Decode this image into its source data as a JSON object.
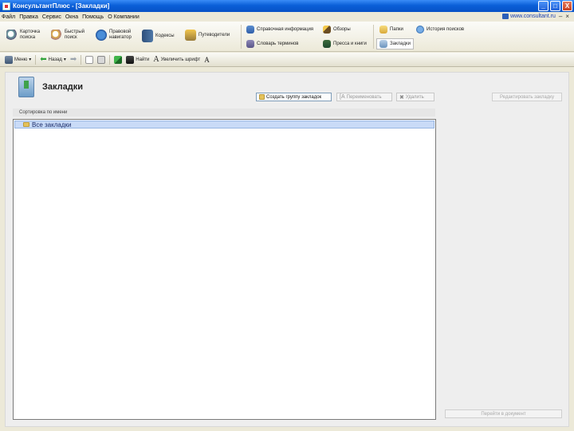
{
  "window": {
    "title": "КонсультантПлюс - [Закладки]",
    "controls": [
      "_",
      "□",
      "X"
    ]
  },
  "menu": {
    "items": [
      "Файл",
      "Правка",
      "Сервис",
      "Окна",
      "Помощь",
      "О Компании"
    ],
    "site_link": "www.consultant.ru",
    "min_ctl": "–",
    "close_ctl": "×"
  },
  "toolbar": {
    "card_search": "Карточка\nпоиска",
    "quick_search": "Быстрый\nпоиск",
    "legal_navigator": "Правовой\nнавигатор",
    "codexes": "Кодексы",
    "guides": "Путеводители",
    "reference_info": "Справочная информация",
    "review": "Обзоры",
    "dictionary": "Словарь терминов",
    "press": "Пресса и книги",
    "folders": "Папки",
    "search_history": "История поисков",
    "bookmarks": "Закладки"
  },
  "toolbar2": {
    "menu": "Меню",
    "back": "Назад",
    "find": "Найти",
    "increase_font": "Увеличить шрифт"
  },
  "page": {
    "title": "Закладки",
    "create_group": "Создать группу закладок",
    "rename": "Переименовать",
    "delete": "Удалить",
    "edit_bookmark": "Редактировать закладку",
    "sort_label": "Сортировка по имени",
    "tree_root": "Все закладки",
    "go_to_document": "Перейти в документ"
  },
  "colors": {
    "titlebar": "#0a5fd8",
    "selection": "#c9dbf7",
    "link": "#1a3fb0"
  }
}
